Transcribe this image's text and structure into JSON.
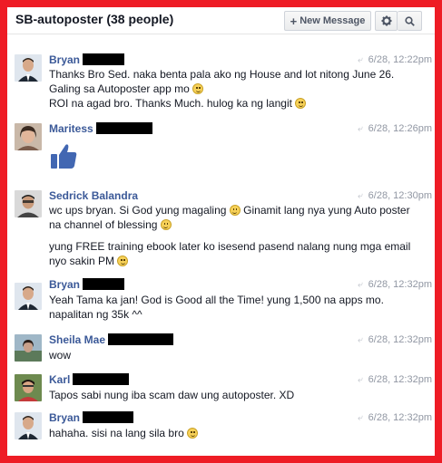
{
  "header": {
    "title": "SB-autoposter (38 people)",
    "new_message_label": "New Message",
    "gear_icon": "gear-icon",
    "search_icon": "search-icon"
  },
  "colors": {
    "border": "#ee1c25",
    "name": "#3b5998",
    "like": "#4267b2"
  },
  "messages": [
    {
      "name": "Bryan",
      "time": "6/28, 12:22pm",
      "lines": [
        "Thanks Bro Sed. naka benta pala ako ng House and lot nitong June 26. Galing sa Autoposter app mo",
        "ROI na agad bro. Thanks Much. hulog ka ng langit"
      ]
    },
    {
      "name": "Maritess",
      "time": "6/28, 12:26pm",
      "sticker": "thumbs-up-icon"
    },
    {
      "name": "Sedrick Balandra",
      "time": "6/28, 12:30pm",
      "paragraphs": [
        "wc ups bryan. Si God yung magaling",
        "Ginamit lang nya yung Auto poster na channel of blessing",
        "yung FREE training ebook later ko isesend pasend nalang nung mga email nyo sakin PM"
      ]
    },
    {
      "name": "Bryan",
      "time": "6/28, 12:32pm",
      "lines": [
        "Yeah Tama ka jan! God is Good all the Time! yung 1,500 na apps mo. napalitan ng 35k ^^"
      ]
    },
    {
      "name": "Sheila Mae",
      "time": "6/28, 12:32pm",
      "lines": [
        "wow"
      ]
    },
    {
      "name": "Karl",
      "time": "6/28, 12:32pm",
      "lines": [
        "Tapos sabi nung iba scam daw ung autoposter. XD"
      ]
    },
    {
      "name": "Bryan",
      "time": "6/28, 12:32pm",
      "lines": [
        "hahaha. sisi na lang sila bro"
      ]
    }
  ]
}
